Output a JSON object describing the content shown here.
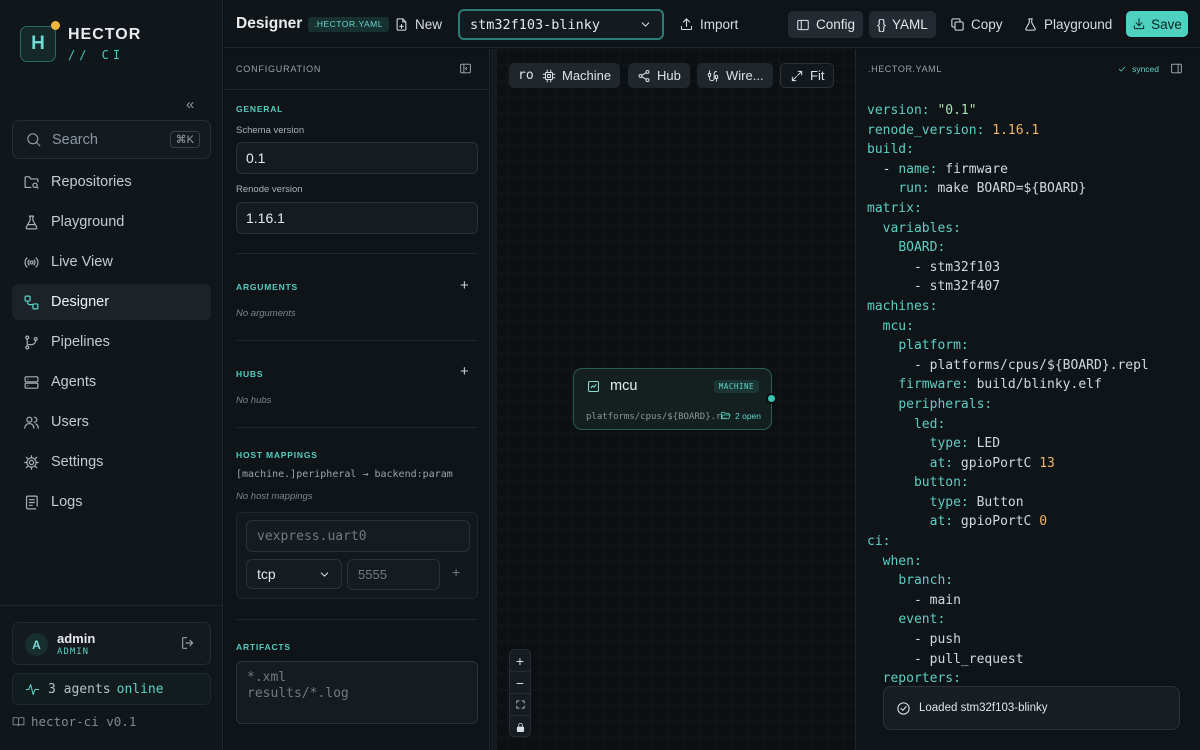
{
  "brand": {
    "initial": "H",
    "name": "HECTOR",
    "sub": "// CI"
  },
  "search": {
    "label": "Search",
    "shortcut": "⌘K"
  },
  "nav": [
    {
      "label": "Repositories",
      "icon": "folder-search-icon"
    },
    {
      "label": "Playground",
      "icon": "flask-icon"
    },
    {
      "label": "Live View",
      "icon": "radio-icon"
    },
    {
      "label": "Designer",
      "icon": "workflow-icon",
      "active": true
    },
    {
      "label": "Pipelines",
      "icon": "git-branch-icon"
    },
    {
      "label": "Agents",
      "icon": "server-icon"
    },
    {
      "label": "Users",
      "icon": "users-icon"
    },
    {
      "label": "Settings",
      "icon": "gear-icon"
    },
    {
      "label": "Logs",
      "icon": "scroll-icon"
    }
  ],
  "user": {
    "initial": "A",
    "name": "admin",
    "role": "ADMIN"
  },
  "agents": {
    "count": "3 agents",
    "status": "online"
  },
  "version": "hector-ci v0.1",
  "topbar": {
    "title": "Designer",
    "file_badge": ".HECTOR.YAML",
    "new_label": "New",
    "project": "stm32f103-blinky",
    "import_label": "Import",
    "config_label": "Config",
    "yaml_label": "YAML",
    "copy_label": "Copy",
    "playground_label": "Playground",
    "save_label": "Save"
  },
  "config": {
    "header": "CONFIGURATION",
    "general": {
      "title": "GENERAL",
      "schema_label": "Schema version",
      "schema_value": "0.1",
      "renode_label": "Renode version",
      "renode_value": "1.16.1"
    },
    "arguments": {
      "title": "ARGUMENTS",
      "empty": "No arguments"
    },
    "hubs": {
      "title": "HUBS",
      "empty": "No hubs"
    },
    "host_mappings": {
      "title": "HOST MAPPINGS",
      "hint": "[machine.]peripheral → backend:param",
      "empty": "No host mappings",
      "peripheral_placeholder": "vexpress.uart0",
      "backend_value": "tcp",
      "param_placeholder": "5555"
    },
    "artifacts": {
      "title": "ARTIFACTS",
      "line1": "*.xml",
      "line2": "results/*.log"
    }
  },
  "canvas": {
    "tools": {
      "root_partial": "ro",
      "machine": "Machine",
      "hub": "Hub",
      "wire": "Wire...",
      "fit": "Fit"
    },
    "node": {
      "name": "mcu",
      "badge": "MACHINE",
      "path": "platforms/cpus/${BOARD}.r…",
      "open": "2 open"
    }
  },
  "yaml_panel": {
    "title": ".HECTOR.YAML",
    "status": "synced"
  },
  "toast": "Loaded stm32f103-blinky"
}
